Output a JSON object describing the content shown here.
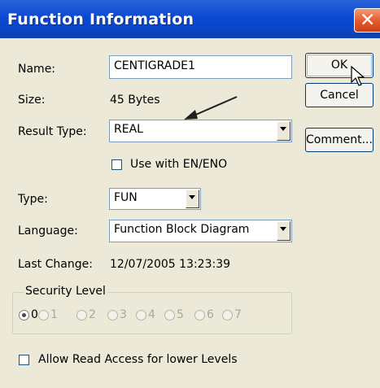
{
  "dialog": {
    "title": "Function Information",
    "close_glyph": "✕"
  },
  "fields": {
    "name_label": "Name:",
    "name_value": "CENTIGRADE1",
    "size_label": "Size:",
    "size_value": "45 Bytes",
    "result_type_label": "Result Type:",
    "result_type_value": "REAL",
    "use_en_eno_label": "Use with EN/ENO",
    "type_label": "Type:",
    "type_value": "FUN",
    "language_label": "Language:",
    "language_value": "Function Block Diagram",
    "last_change_label": "Last Change:",
    "last_change_value": "12/07/2005 13:23:39"
  },
  "buttons": {
    "ok": "OK",
    "cancel": "Cancel",
    "comment": "Comment..."
  },
  "security": {
    "caption": "Security Level",
    "levels": [
      "0",
      "1",
      "2",
      "3",
      "4",
      "5",
      "6",
      "7"
    ],
    "selected": "0"
  },
  "allow_read_label": "Allow Read Access for lower Levels",
  "icons": [
    "close-icon",
    "dropdown-arrow-icon",
    "mouse-pointer-icon",
    "annotation-arrow"
  ],
  "colors": {
    "title_bar": "#0A49D3",
    "dialog_bg": "#ECE9D8",
    "close_button": "#E1592A"
  }
}
